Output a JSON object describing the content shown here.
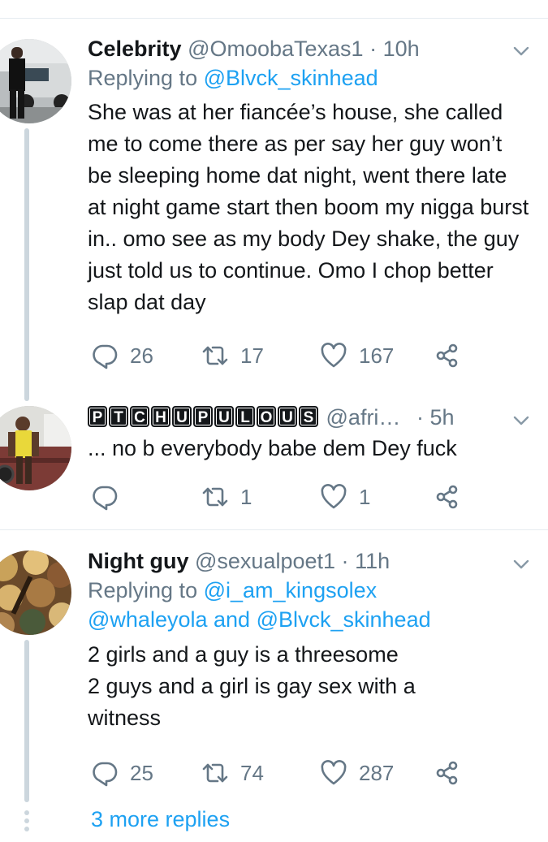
{
  "tweets": [
    {
      "name": "Celebrity",
      "handle": "@OmoobaTexas1",
      "dot": "·",
      "time": "10h",
      "replying_prefix": "Replying to",
      "replying_to": "@Blvck_skinhead",
      "text": "She was at her fiancée’s house, she called me to come there as per say her guy won’t be sleeping home dat night, went there late at night game start then boom my nigga burst in.. omo see as my body Dey shake, the guy just told us to continue. Omo I chop better slap dat day",
      "replies": "26",
      "retweets": "17",
      "likes": "167"
    },
    {
      "name_letters": [
        "P",
        "T",
        "C",
        "H",
        "U",
        "P",
        "U",
        "L",
        "O",
        "U",
        "S"
      ],
      "handle": "@afri…",
      "dot": "·",
      "time": "5h",
      "text": "... no b everybody babe dem Dey fuck",
      "replies": "",
      "retweets": "1",
      "likes": "1"
    },
    {
      "name": "Night guy",
      "handle": "@sexualpoet1",
      "dot": "·",
      "time": "11h",
      "replying_prefix": "Replying to",
      "replying_to_1": "@i_am_kingsolex",
      "replying_to_2": "@whaleyola",
      "replying_and": "and",
      "replying_to_3": "@Blvck_skinhead",
      "text_line1": "2 girls and a guy is a threesome",
      "text_line2": "2 guys and a girl is gay sex with a witness",
      "replies": "25",
      "retweets": "74",
      "likes": "287"
    }
  ],
  "more_replies": "3 more replies",
  "colors": {
    "accent": "#1da1f2",
    "muted": "#657786",
    "text": "#14171a",
    "divider": "#e6ecf0"
  },
  "icons": [
    "reply-icon",
    "retweet-icon",
    "like-icon",
    "share-icon",
    "chevron-down-icon"
  ]
}
